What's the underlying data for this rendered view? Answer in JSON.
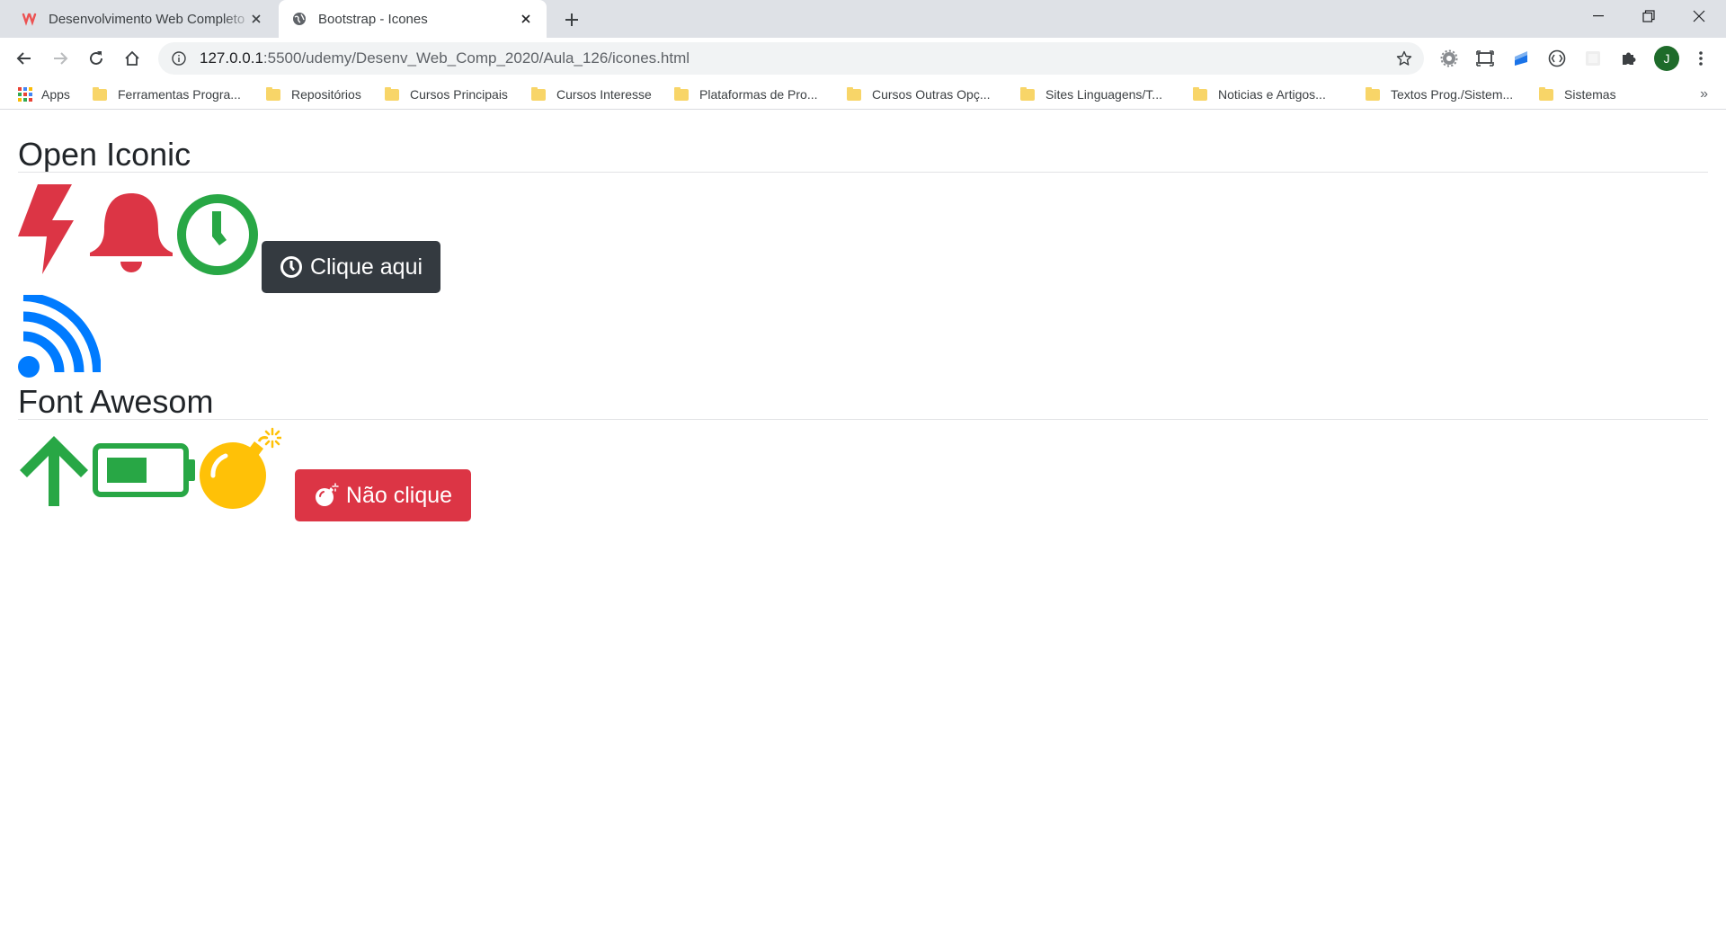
{
  "browser": {
    "tabs": [
      {
        "title": "Desenvolvimento Web Completo",
        "favicon": "udemy-logo-icon",
        "active": false
      },
      {
        "title": "Bootstrap - Icones",
        "favicon": "globe-icon",
        "active": true
      }
    ],
    "address": {
      "host": "127.0.0.1",
      "path": ":5500/udemy/Desenv_Web_Comp_2020/Aula_126/icones.html"
    },
    "profile_initial": "J",
    "bookmarks": [
      "Apps",
      "Ferramentas Progra...",
      "Repositórios",
      "Cursos Principais",
      "Cursos Interesse",
      "Plataformas de Pro...",
      "Cursos Outras Opç...",
      "Sites Linguagens/T...",
      "Noticias e Artigos...",
      "Textos Prog./Sistem...",
      "Sistemas"
    ],
    "bookmarks_overflow": "»"
  },
  "page": {
    "section1": {
      "heading": "Open Iconic",
      "icons": [
        "bolt-icon",
        "bell-icon",
        "clock-icon",
        "rss-icon"
      ],
      "button_label": "Clique aqui",
      "button_icon": "clock-icon"
    },
    "section2": {
      "heading": "Font Awesom",
      "icons": [
        "arrow-up-icon",
        "battery-half-icon",
        "bomb-icon"
      ],
      "button_label": "Não clique",
      "button_icon": "bomb-icon"
    }
  },
  "colors": {
    "danger": "#dc3545",
    "success": "#28a745",
    "primary": "#007bff",
    "warning": "#ffc107",
    "dark": "#343a40",
    "heading": "#212529"
  }
}
